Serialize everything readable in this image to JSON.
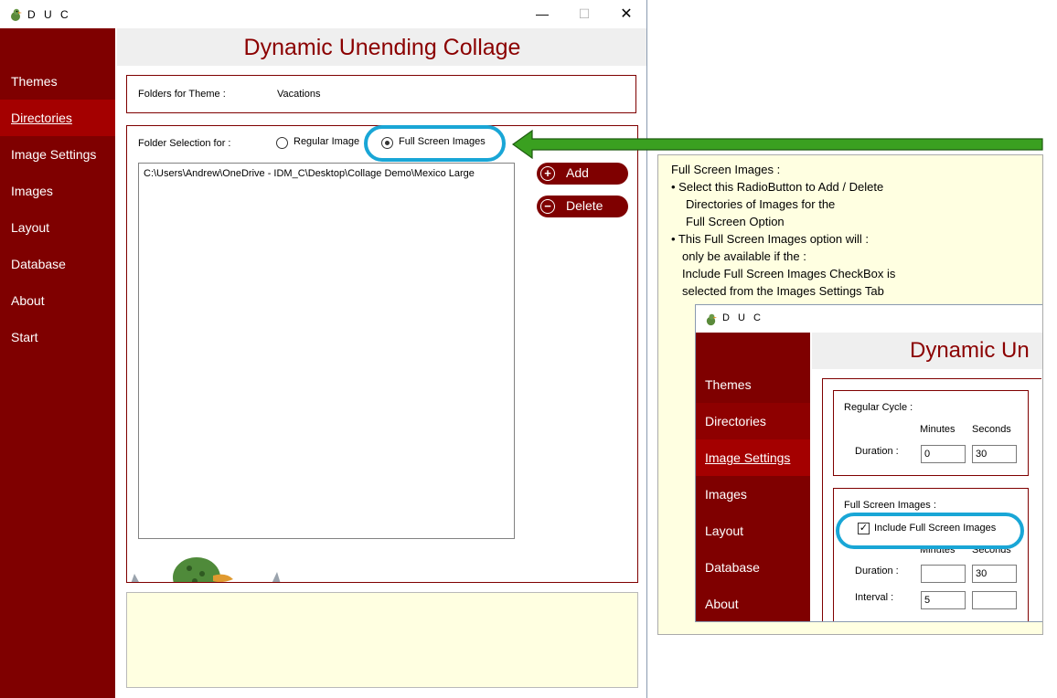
{
  "window": {
    "title": "D U C",
    "minimize_glyph": "—",
    "maximize_glyph": "☐",
    "close_glyph": "✕"
  },
  "sidebar": {
    "items": [
      {
        "label": "Themes"
      },
      {
        "label": "Directories"
      },
      {
        "label": "Image Settings"
      },
      {
        "label": "Images"
      },
      {
        "label": "Layout"
      },
      {
        "label": "Database"
      },
      {
        "label": "About"
      },
      {
        "label": "Start"
      }
    ],
    "active": "Directories"
  },
  "header": {
    "title": "Dynamic Unending Collage"
  },
  "theme": {
    "label": "Folders for Theme :",
    "value": "Vacations"
  },
  "folder_selection": {
    "label": "Folder Selection for :",
    "regular_label": "Regular Image",
    "full_label": "Full Screen Images",
    "selected": "Full Screen Images"
  },
  "folder_list": {
    "items": [
      "C:\\Users\\Andrew\\OneDrive - IDM_C\\Desktop\\Collage Demo\\Mexico Large"
    ]
  },
  "buttons": {
    "add_label": "Add",
    "delete_label": "Delete",
    "add_glyph": "+",
    "delete_glyph": "−"
  },
  "callout": {
    "lines": [
      "Full Screen Images :",
      "•   Select this RadioButton to Add / Delete",
      "Directories of Images for the",
      "Full Screen Option",
      "• This Full Screen Images option will :",
      "only be available if the :",
      "Include Full Screen Images",
      " CheckBox is",
      "selected from the Images Settings Tab"
    ]
  },
  "mini": {
    "title": "D U C",
    "header_title": "Dynamic Un",
    "nav": [
      "Themes",
      "Directories",
      "Image Settings",
      "Images",
      "Layout",
      "Database",
      "About"
    ],
    "regular": {
      "title": "Regular Cycle :",
      "minutes_label": "Minutes",
      "seconds_label": "Seconds",
      "duration_label": "Duration :",
      "duration_minutes": "0",
      "duration_seconds": "30"
    },
    "full": {
      "title": "Full Screen Images :",
      "checkbox_label": "Include Full Screen Images",
      "checkbox_checked": true,
      "check_glyph": "✓",
      "minutes_label": "Minutes",
      "seconds_label": "Seconds",
      "duration_label": "Duration :",
      "duration_minutes": "",
      "duration_seconds": "30",
      "interval_label": "Interval :",
      "interval_minutes": "5",
      "interval_seconds": ""
    }
  },
  "colors": {
    "brand": "#7f0000",
    "active_nav": "#a40000",
    "highlight": "#19a6d6",
    "arrow_fill": "#3aa020",
    "arrow_stroke": "#1e5c10",
    "callout_bg": "#ffffe1"
  }
}
